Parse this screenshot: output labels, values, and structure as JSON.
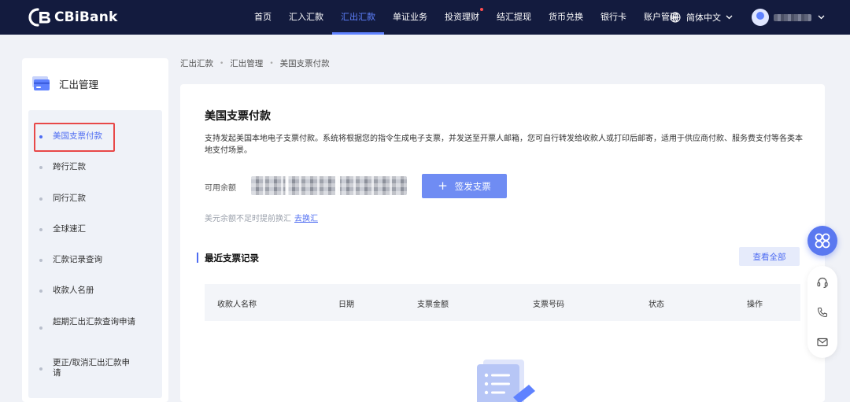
{
  "brand": {
    "name": "CBiBank"
  },
  "nav": {
    "items": [
      {
        "label": "首页"
      },
      {
        "label": "汇入汇款"
      },
      {
        "label": "汇出汇款",
        "active": true
      },
      {
        "label": "单证业务"
      },
      {
        "label": "投资理财",
        "badge_dot": true
      },
      {
        "label": "结汇提现"
      },
      {
        "label": "货币兑换"
      },
      {
        "label": "银行卡"
      },
      {
        "label": "账户管理"
      }
    ],
    "language": "简体中文"
  },
  "sidebar": {
    "title": "汇出管理",
    "items": [
      {
        "label": "美国支票付款",
        "active": true
      },
      {
        "label": "跨行汇款"
      },
      {
        "label": "同行汇款"
      },
      {
        "label": "全球速汇"
      },
      {
        "label": "汇款记录查询"
      },
      {
        "label": "收款人名册"
      },
      {
        "label": "超期汇出汇款查询申请"
      },
      {
        "label": "更正/取消汇出汇款申请"
      }
    ]
  },
  "breadcrumb": [
    "汇出汇款",
    "汇出管理",
    "美国支票付款"
  ],
  "main": {
    "title": "美国支票付款",
    "description": "支持发起美国本地电子支票付款。系统将根据您的指令生成电子支票，并发送至开票人邮箱，您可自行转发给收款人或打印后邮寄，适用于供应商付款、服务费支付等各类本地支付场景。",
    "balance_label": "可用余额",
    "issue_button": "签发支票",
    "hint": "美元余额不足时提前换汇",
    "hint_link": "去换汇",
    "recent_title": "最近支票记录",
    "view_all": "查看全部",
    "table_headers": [
      "收款人名称",
      "日期",
      "支票金额",
      "支票号码",
      "状态",
      "操作"
    ]
  },
  "colors": {
    "nav_bg": "#131b3e",
    "accent": "#4e6cf2",
    "button": "#6f8cf3",
    "highlight_border": "#e84848"
  }
}
